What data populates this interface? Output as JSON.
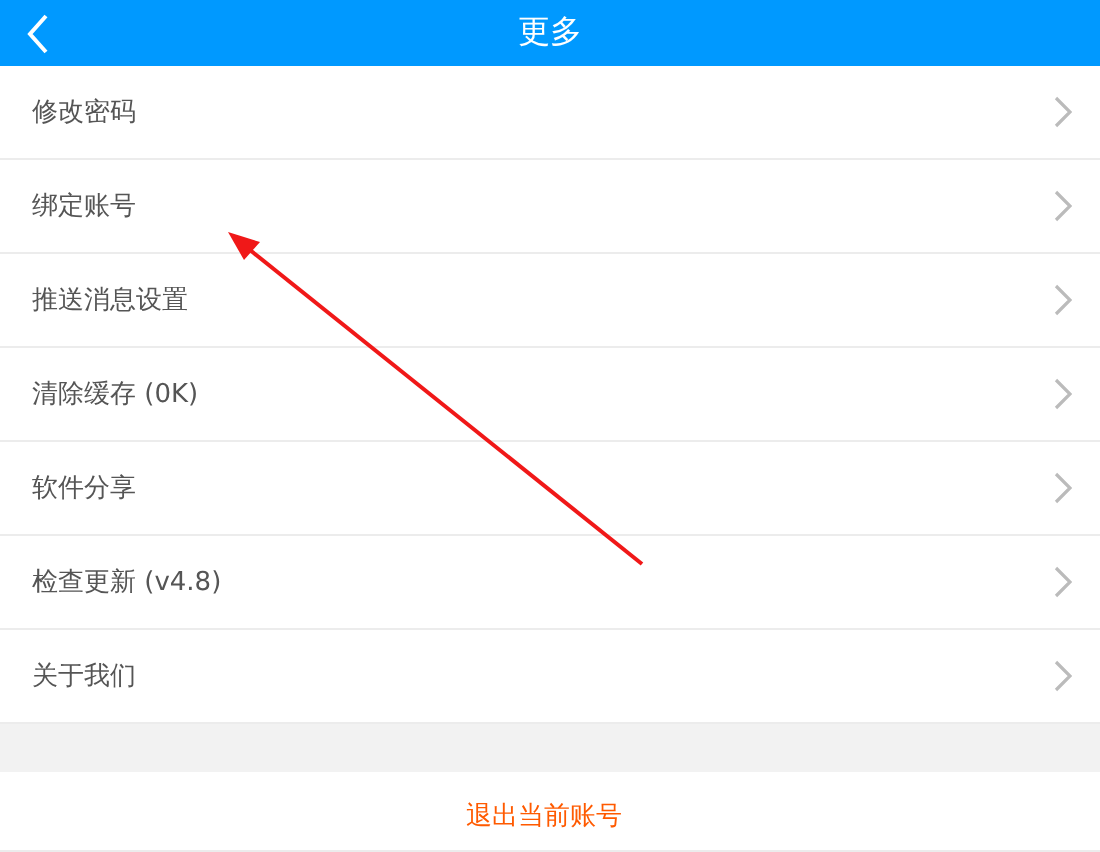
{
  "header": {
    "title": "更多"
  },
  "menu_items": [
    {
      "label": "修改密码"
    },
    {
      "label": "绑定账号"
    },
    {
      "label": "推送消息设置"
    },
    {
      "label": "清除缓存 (0K)"
    },
    {
      "label": "软件分享"
    },
    {
      "label": "检查更新 (v4.8)"
    },
    {
      "label": "关于我们"
    }
  ],
  "logout_button": {
    "label": "退出当前账号"
  }
}
